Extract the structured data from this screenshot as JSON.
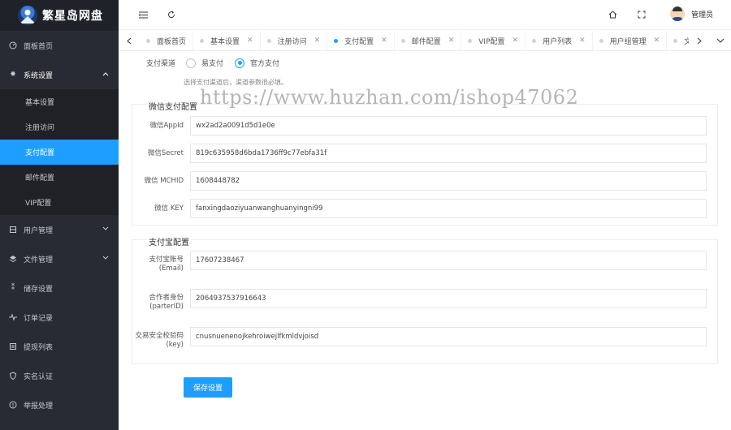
{
  "app": {
    "logo_text": "繁星岛网盘"
  },
  "sidebar": {
    "items": [
      {
        "label": "面板首页",
        "icon": "gauge-icon"
      },
      {
        "label": "系统设置",
        "icon": "gear-icon",
        "open": true,
        "children": [
          {
            "label": "基本设置"
          },
          {
            "label": "注册访问"
          },
          {
            "label": "支付配置",
            "active": true
          },
          {
            "label": "邮件配置"
          },
          {
            "label": "VIP配置"
          }
        ]
      },
      {
        "label": "用户管理",
        "icon": "user-icon"
      },
      {
        "label": "文件管理",
        "icon": "layers-icon"
      },
      {
        "label": "储存设置",
        "icon": "storage-icon"
      },
      {
        "label": "订单记录",
        "icon": "pulse-icon"
      },
      {
        "label": "提现列表",
        "icon": "list-icon"
      },
      {
        "label": "实名认证",
        "icon": "shield-icon"
      },
      {
        "label": "举报处理",
        "icon": "alert-icon"
      }
    ]
  },
  "topbar": {
    "user_name": "管理员"
  },
  "tabs": [
    {
      "label": "面板首页"
    },
    {
      "label": "基本设置"
    },
    {
      "label": "注册访问"
    },
    {
      "label": "支付配置",
      "active": true
    },
    {
      "label": "邮件配置"
    },
    {
      "label": "VIP配置"
    },
    {
      "label": "用户列表"
    },
    {
      "label": "用户组管理"
    },
    {
      "label": "文"
    }
  ],
  "form": {
    "channel_label": "支付渠道",
    "channel_options": [
      "易支付",
      "官方支付"
    ],
    "channel_selected": "官方支付",
    "hint": "选择支付渠道后，渠道参数很必填。",
    "wechat": {
      "legend": "微信支付配置",
      "fields": [
        {
          "label": "微信AppId",
          "value": "wx2ad2a0091d5d1e0e"
        },
        {
          "label": "微信Secret",
          "value": "819c635958d6bda1736ff9c77ebfa31f"
        },
        {
          "label": "微信 MCHID",
          "value": "1608448782"
        },
        {
          "label": "微信 KEY",
          "value": "fanxingdaoziyuanwanghuanyingni99"
        }
      ]
    },
    "alipay": {
      "legend": "支付宝配置",
      "fields": [
        {
          "label": "支付宝账号(Email)",
          "value": "17607238467"
        },
        {
          "label": "合作者身份(parterID)",
          "value": "2064937537916643"
        },
        {
          "label": "交易安全校验码(key)",
          "value": "cnusnuenenojkehroiwejlfkmldvjoisd"
        }
      ]
    },
    "save_label": "保存设置"
  },
  "watermark": "https://www.huzhan.com/ishop47062",
  "colors": {
    "accent": "#1e9fff",
    "sidebar_bg": "#282b33"
  }
}
